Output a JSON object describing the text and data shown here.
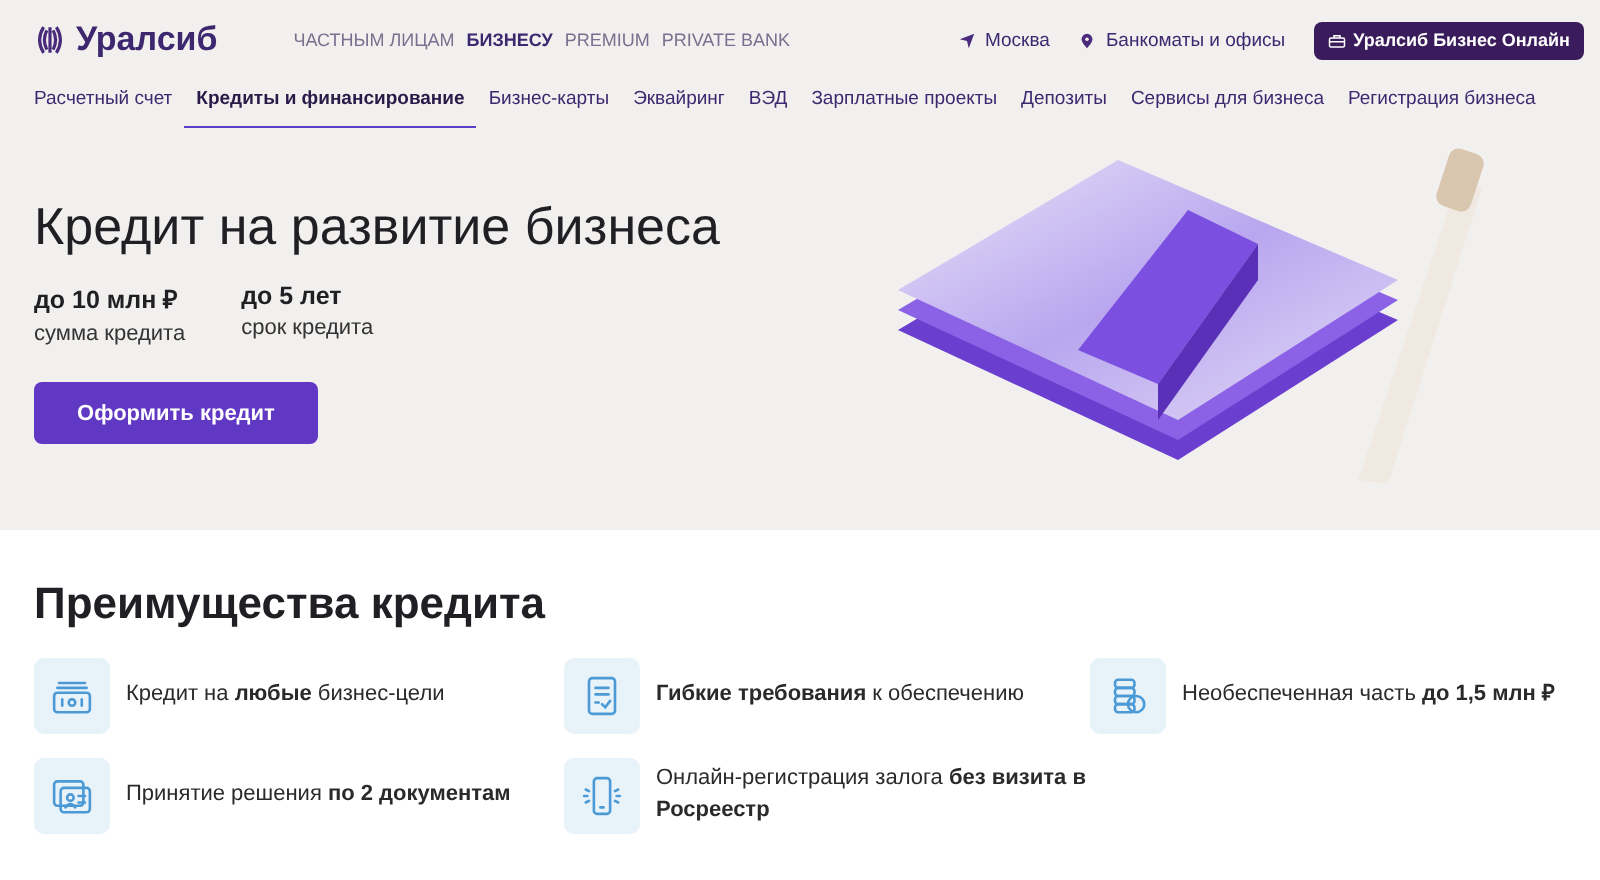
{
  "header": {
    "logo": "Уралсиб",
    "segments": [
      {
        "label": "ЧАСТНЫМ ЛИЦАМ",
        "selected": false
      },
      {
        "label": "БИЗНЕСУ",
        "selected": true
      },
      {
        "label": "PREMIUM",
        "selected": false
      },
      {
        "label": "PRIVATE BANK",
        "selected": false
      }
    ],
    "city": "Москва",
    "atm_link": "Банкоматы и офисы",
    "online_button": "Уралсиб Бизнес Онлайн"
  },
  "nav": [
    {
      "label": "Расчетный счет",
      "selected": false
    },
    {
      "label": "Кредиты и финансирование",
      "selected": true
    },
    {
      "label": "Бизнес-карты",
      "selected": false
    },
    {
      "label": "Эквайринг",
      "selected": false
    },
    {
      "label": "ВЭД",
      "selected": false
    },
    {
      "label": "Зарплатные проекты",
      "selected": false
    },
    {
      "label": "Депозиты",
      "selected": false
    },
    {
      "label": "Сервисы для бизнеса",
      "selected": false
    },
    {
      "label": "Регистрация бизнеса",
      "selected": false
    }
  ],
  "hero": {
    "title": "Кредит на развитие бизнеса",
    "stats": [
      {
        "value": "до 10 млн ₽",
        "caption": "сумма кредита"
      },
      {
        "value": "до 5 лет",
        "caption": "срок кредита"
      }
    ],
    "button": "Оформить кредит"
  },
  "benefits": {
    "title": "Преимущества кредита",
    "items": [
      {
        "kind": "money",
        "text": "Кредит на **любые** бизнес-цели"
      },
      {
        "kind": "document",
        "text": "**Гибкие требования** к обеспечению"
      },
      {
        "kind": "coins",
        "text": "Необеспеченная часть **до 1,5 млн ₽**"
      },
      {
        "kind": "id",
        "text": "Принятие решения **по 2 документам**"
      },
      {
        "kind": "phone",
        "text": "Онлайн-регистрация залога **без визита в Росреестр**"
      }
    ]
  }
}
